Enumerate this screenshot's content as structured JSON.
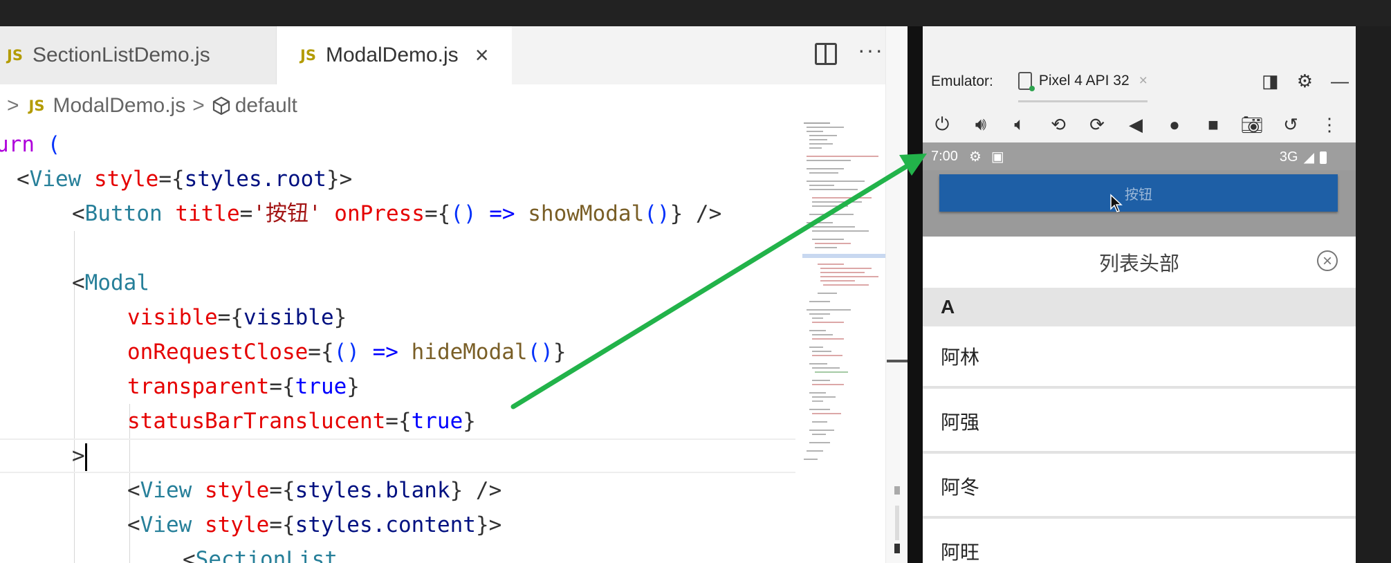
{
  "editor": {
    "tabs": [
      {
        "badge": "JS",
        "label": "SectionListDemo.js"
      },
      {
        "badge": "JS",
        "label": "ModalDemo.js",
        "close": "×"
      }
    ],
    "more": "···",
    "breadcrumb": {
      "sep1": ">",
      "badge": "JS",
      "file": "ModalDemo.js",
      "sep2": ">",
      "symbol": "default"
    }
  },
  "code": {
    "l0_kw": "urn",
    "l0_p": " (",
    "l1_a": "<",
    "l1_tag": "View",
    "l1_attr": " style",
    "l1_b": "={",
    "l1_val": "styles.root",
    "l1_c": "}>",
    "l2_a": "<",
    "l2_tag": "Button",
    "l2_attr1": " title",
    "l2_b": "=",
    "l2_str": "'按钮'",
    "l2_attr2": " onPress",
    "l2_c": "={",
    "l2_par": "()",
    "l2_arrow": " =>",
    "l2_fn": " showModal",
    "l2_call": "()",
    "l2_d": "} />",
    "l4_a": "<",
    "l4_tag": "Modal",
    "l5_attr": "visible",
    "l5_b": "={",
    "l5_val": "visible",
    "l5_c": "}",
    "l6_attr": "onRequestClose",
    "l6_b": "={",
    "l6_par": "()",
    "l6_arrow": " =>",
    "l6_fn": " hideModal",
    "l6_call": "()",
    "l6_c": "}",
    "l7_attr": "transparent",
    "l7_b": "={",
    "l7_val": "true",
    "l7_c": "}",
    "l8_attr": "statusBarTranslucent",
    "l8_b": "={",
    "l8_val": "true",
    "l8_c": "}",
    "l9": ">",
    "l10_a": "<",
    "l10_tag": "View",
    "l10_attr": " style",
    "l10_b": "={",
    "l10_val": "styles.blank",
    "l10_c": "} />",
    "l11_a": "<",
    "l11_tag": "View",
    "l11_attr": " style",
    "l11_b": "={",
    "l11_val": "styles.content",
    "l11_c": "}>",
    "l12_a": "<",
    "l12_tag": "SectionList"
  },
  "emulator": {
    "label": "Emulator:",
    "device": "Pixel 4 API 32",
    "device_close": "×",
    "controls": [
      "power-icon",
      "volume-up-icon",
      "volume-down-icon",
      "rotate-left-icon",
      "rotate-right-icon",
      "back-icon",
      "home-icon",
      "overview-icon",
      "camera-icon",
      "snapshot-icon",
      "more-icon"
    ]
  },
  "phone": {
    "time": "7:00",
    "network": "3G",
    "button_title": "按钮",
    "list_header": "列表头部",
    "section": "A",
    "items": [
      "阿林",
      "阿强",
      "阿冬",
      "阿旺"
    ]
  },
  "colors": {
    "arrow": "#22b34a",
    "button": "#1e5fa6",
    "keyword": "#0000ff",
    "tag": "#267f99",
    "attribute": "#e50000"
  }
}
